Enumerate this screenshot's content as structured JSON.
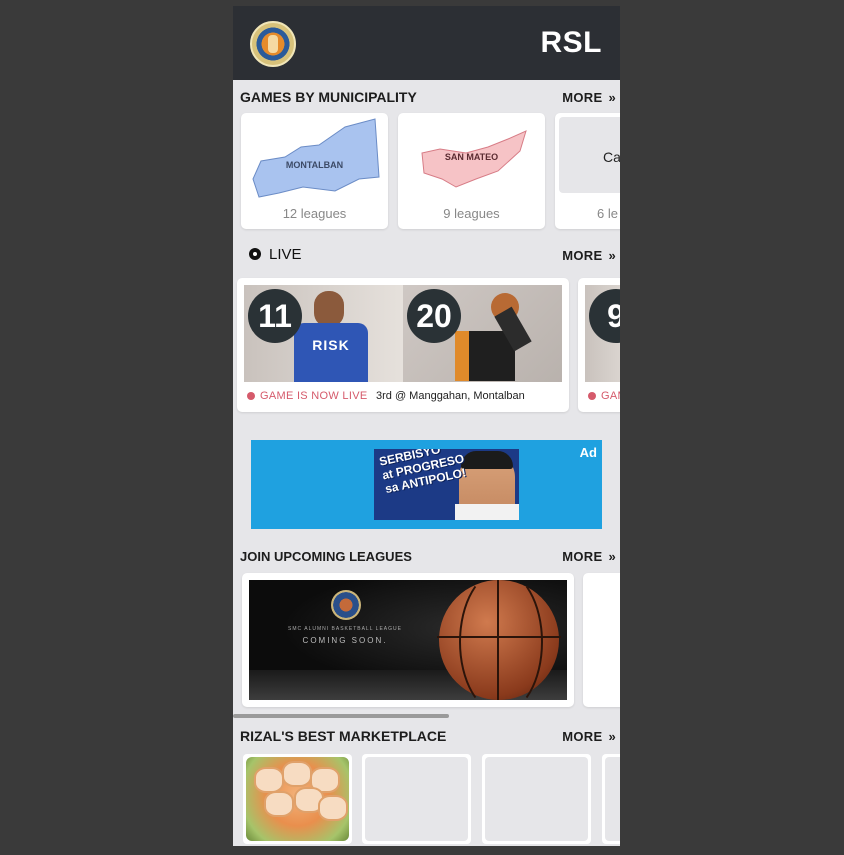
{
  "header": {
    "brand": "RSL"
  },
  "municipalities": {
    "title": "GAMES BY MUNICIPALITY",
    "more_label": "MORE",
    "cards": [
      {
        "map_label": "MONTALBAN",
        "leagues": "12 leagues",
        "color": "#a9c3ef"
      },
      {
        "map_label": "SAN MATEO",
        "leagues": "9 leagues",
        "color": "#f6c3c6"
      },
      {
        "map_label": "Ca",
        "leagues": "6 le"
      }
    ]
  },
  "live": {
    "title": "LIVE",
    "more_label": "MORE",
    "games": [
      {
        "score_home": "11",
        "score_away": "20",
        "status": "GAME IS NOW LIVE",
        "venue": "3rd @ Manggahan, Montalban",
        "jersey": "RISK"
      },
      {
        "score_home": "9",
        "status": "GAM"
      }
    ]
  },
  "ad": {
    "tag": "Ad",
    "line1": "SERBISYO",
    "line2": "at PROGRESO",
    "line3": "sa ANTIPOLO!"
  },
  "upcoming": {
    "title": "JOIN UPCOMING LEAGUES",
    "more_label": "MORE",
    "league_small": "SMC ALUMNI BASKETBALL LEAGUE",
    "league_status": "COMING SOON."
  },
  "marketplace": {
    "title": "RIZAL'S BEST MARKETPLACE",
    "more_label": "MORE"
  },
  "colors": {
    "topbar": "#2c2f34",
    "live_red": "#d55a6b",
    "ad_blue": "#1fa1e0"
  }
}
